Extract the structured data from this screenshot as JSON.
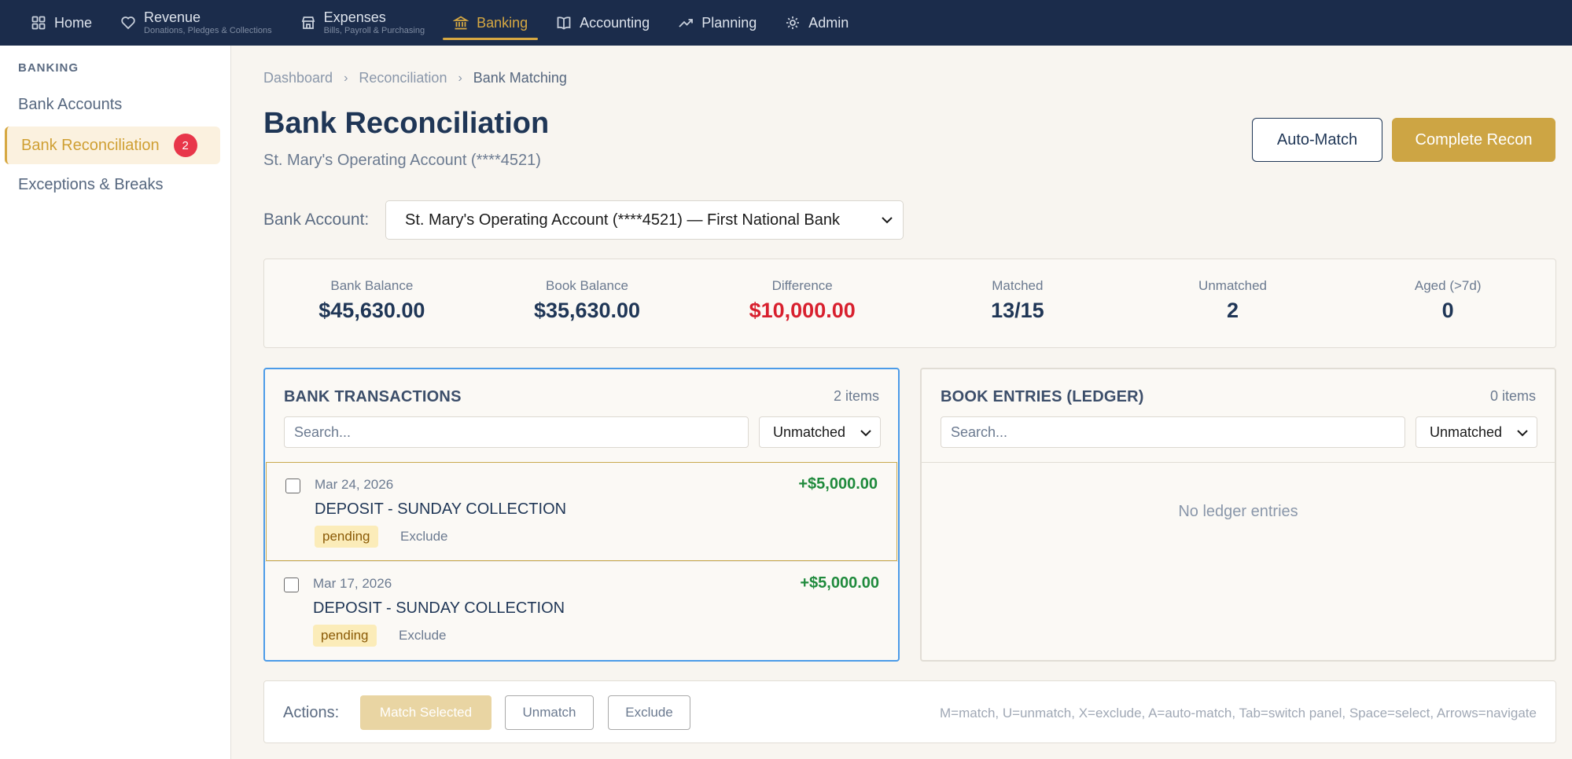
{
  "nav": {
    "items": [
      {
        "label": "Home",
        "sub": "",
        "icon": "home-grid-icon"
      },
      {
        "label": "Revenue",
        "sub": "Donations, Pledges & Collections",
        "icon": "heart-icon"
      },
      {
        "label": "Expenses",
        "sub": "Bills, Payroll & Purchasing",
        "icon": "store-icon"
      },
      {
        "label": "Banking",
        "sub": "",
        "icon": "bank-icon",
        "active": true
      },
      {
        "label": "Accounting",
        "sub": "",
        "icon": "book-icon"
      },
      {
        "label": "Planning",
        "sub": "",
        "icon": "trend-up-icon"
      },
      {
        "label": "Admin",
        "sub": "",
        "icon": "gear-icon"
      }
    ]
  },
  "sidebar": {
    "heading": "BANKING",
    "items": [
      {
        "label": "Bank Accounts"
      },
      {
        "label": "Bank Reconciliation",
        "badge": "2",
        "active": true
      },
      {
        "label": "Exceptions & Breaks"
      }
    ]
  },
  "breadcrumb": [
    "Dashboard",
    "Reconciliation",
    "Bank Matching"
  ],
  "page": {
    "title": "Bank Reconciliation",
    "subtitle": "St. Mary's Operating Account (****4521)",
    "auto_match_label": "Auto-Match",
    "complete_label": "Complete Recon"
  },
  "account": {
    "label": "Bank Account:",
    "selected": "St. Mary's Operating Account (****4521) — First National Bank"
  },
  "stats": [
    {
      "label": "Bank Balance",
      "value": "$45,630.00"
    },
    {
      "label": "Book Balance",
      "value": "$35,630.00"
    },
    {
      "label": "Difference",
      "value": "$10,000.00",
      "color": "#d8202e"
    },
    {
      "label": "Matched",
      "value": "13/15"
    },
    {
      "label": "Unmatched",
      "value": "2"
    },
    {
      "label": "Aged (>7d)",
      "value": "0"
    }
  ],
  "bank_panel": {
    "title": "BANK TRANSACTIONS",
    "count": "2 items",
    "search_placeholder": "Search...",
    "filter": "Unmatched",
    "transactions": [
      {
        "date": "Mar 24, 2026",
        "description": "DEPOSIT - SUNDAY COLLECTION",
        "amount": "+$5,000.00",
        "status": "pending",
        "exclude": "Exclude"
      },
      {
        "date": "Mar 17, 2026",
        "description": "DEPOSIT - SUNDAY COLLECTION",
        "amount": "+$5,000.00",
        "status": "pending",
        "exclude": "Exclude"
      }
    ]
  },
  "book_panel": {
    "title": "BOOK ENTRIES (LEDGER)",
    "count": "0 items",
    "search_placeholder": "Search...",
    "filter": "Unmatched",
    "empty": "No ledger entries"
  },
  "actions": {
    "label": "Actions:",
    "match": "Match Selected",
    "unmatch": "Unmatch",
    "exclude": "Exclude",
    "shortcuts": "M=match, U=unmatch, X=exclude, A=auto-match, Tab=switch panel, Space=select, Arrows=navigate"
  },
  "colors": {
    "nav_bg": "#1b2c4b",
    "accent_gold": "#d6a842",
    "danger": "#d8202e",
    "positive": "#1f8a3c",
    "focus_blue": "#4c9be8"
  }
}
